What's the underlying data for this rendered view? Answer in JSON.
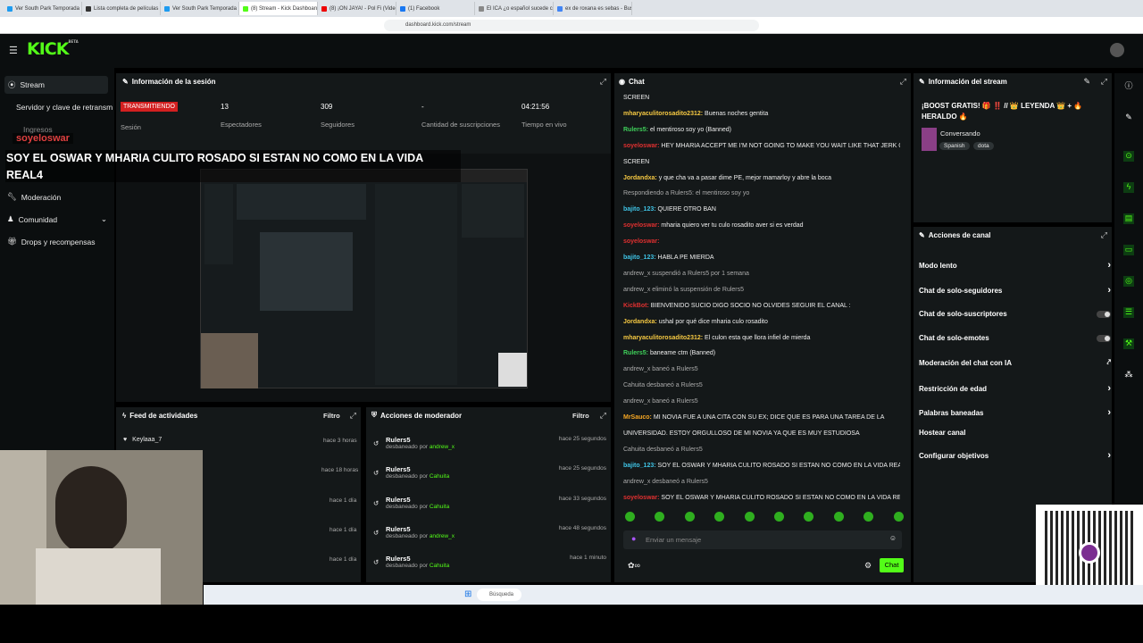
{
  "browser": {
    "tabs": [
      "Ver South Park Temporada 19 Episo",
      "Lista completa de películas Página 1",
      "Ver South Park Temporada 18 Episo",
      "(8) Stream - Kick Dashboard",
      "(8) ¡ON JAYA! - Pol Fi (Video Oficial)",
      "(1) Facebook",
      "El ICA ¿o español sucede con el Pedro",
      "ex de roxana es sebas - Buscar con G"
    ],
    "url": "dashboard.kick.com/stream"
  },
  "brand": {
    "logo": "KICK",
    "beta": "BETA",
    "accent": "#53fc18"
  },
  "sidebar": {
    "items": [
      {
        "label": "Stream",
        "icon": "video-icon"
      },
      {
        "label": "Servidor y clave de retransm"
      },
      {
        "label": "Ingresos"
      },
      {
        "label": "Moderación",
        "icon": "wrench-icon"
      },
      {
        "label": "Comunidad",
        "icon": "community-icon"
      },
      {
        "label": "Drops y recompensas",
        "icon": "gift-icon"
      }
    ],
    "overlay_name": "soyeloswar"
  },
  "session": {
    "title": "Información de la sesión",
    "status": "TRANSMITIENDO",
    "session_label": "Sesión",
    "stats": [
      {
        "value": "13",
        "label": "Espectadores"
      },
      {
        "value": "309",
        "label": "Seguidores"
      },
      {
        "value": "-",
        "label": "Cantidad de suscripciones"
      },
      {
        "value": "04:21:56",
        "label": "Tiempo en vivo"
      }
    ]
  },
  "overlay_text": "SOY EL OSWAR Y MHARIA CULITO ROSADO SI ESTAN NO COMO EN LA VIDA REAL4",
  "chat": {
    "title": "Chat",
    "placeholder": "Enviar un mensaje",
    "send": "Chat",
    "messages": [
      {
        "user": "",
        "text": "SCREEN"
      },
      {
        "user": "mharyaculitorosadito2312:",
        "text": "Buenas noches gentita",
        "color": "#f5c842"
      },
      {
        "user": "Rulers5:",
        "text": "el mentiroso soy yo (Banned)",
        "color": "#3fd15a"
      },
      {
        "user": "soyeloswar:",
        "text": "HEY MHARIA ACCEPT ME I'M NOT GOING TO MAKE YOU WAIT LIKE THAT JERK ON THE",
        "color": "#e03030"
      },
      {
        "user": "",
        "text": "SCREEN"
      },
      {
        "user": "Jordandxa:",
        "text": "y que cha va a pasar dime PE, mejor mamarloy y abre la boca",
        "color": "#f5c842"
      },
      {
        "user": "",
        "text": "Respondiendo a Rulers5: el mentiroso soy yo",
        "sys": true
      },
      {
        "user": "bajito_123:",
        "text": "QUIERE OTRO BAN",
        "color": "#3fc4e6"
      },
      {
        "user": "soyeloswar:",
        "text": "mharia quiero ver tu culo rosadito aver si es verdad",
        "color": "#e03030"
      },
      {
        "user": "soyeloswar:",
        "text": "",
        "color": "#e03030"
      },
      {
        "user": "bajito_123:",
        "text": "HABLA PE MIERDA",
        "color": "#3fc4e6"
      },
      {
        "user": "",
        "text": "andrew_x suspendió a Rulers5 por 1 semana",
        "sys": true
      },
      {
        "user": "",
        "text": "andrew_x eliminó la suspensión de Rulers5",
        "sys": true
      },
      {
        "user": "KickBot:",
        "text": "BIENVENIDO SUCIO DIGO SOCIO NO OLVIDES SEGUIR EL CANAL :",
        "color": "#e03030"
      },
      {
        "user": "Jordandxa:",
        "text": "ushal por qué dice mharia culo rosadito",
        "color": "#f5c842"
      },
      {
        "user": "mharyaculitorosadito2312:",
        "text": "El culon esta que llora infiel de mierda",
        "color": "#f5c842"
      },
      {
        "user": "Rulers5:",
        "text": "baneame ctm (Banned)",
        "color": "#3fd15a"
      },
      {
        "user": "",
        "text": "andrew_x baneó a Rulers5",
        "sys": true
      },
      {
        "user": "",
        "text": "Cahuita desbaneó a Rulers5",
        "sys": true
      },
      {
        "user": "",
        "text": "andrew_x baneó a Rulers5",
        "sys": true
      },
      {
        "user": "MrSauco:",
        "text": "MI NOVIA FUE A UNA CITA CON SU EX; DICE QUE ES PARA UNA TAREA DE LA",
        "color": "#f5a623"
      },
      {
        "user": "",
        "text": "UNIVERSIDAD. ESTOY ORGULLOSO DE MI NOVIA YA QUE ES MUY ESTUDIOSA"
      },
      {
        "user": "",
        "text": "Cahuita desbaneó a Rulers5",
        "sys": true
      },
      {
        "user": "bajito_123:",
        "text": "SOY EL OSWAR Y MHARIA CULITO ROSADO SI ESTAN NO COMO EN LA VIDA REAL",
        "color": "#3fc4e6"
      },
      {
        "user": "",
        "text": "andrew_x desbaneó a Rulers5",
        "sys": true
      },
      {
        "user": "soyeloswar:",
        "text": "SOY EL OSWAR Y MHARIA CULITO ROSADO SI ESTAN NO COMO EN LA VIDA REAL4",
        "color": "#e03030"
      }
    ]
  },
  "stream_info": {
    "title": "Información del stream",
    "stream_title": "¡BOOST GRATIS! 🎁 ‼️ // 👑 LEYENDA 👑 + 🔥 HERALDO 🔥",
    "category": "Conversando",
    "tags": [
      "Spanish",
      "dota"
    ]
  },
  "channel_actions": {
    "title": "Acciones de canal",
    "items": [
      {
        "label": "Modo lento",
        "control": "chevron"
      },
      {
        "label": "Chat de solo-seguidores",
        "control": "chevron"
      },
      {
        "label": "Chat de solo-suscriptores",
        "control": "toggle"
      },
      {
        "label": "Chat de solo-emotes",
        "control": "toggle"
      },
      {
        "label": "Moderación del chat con IA",
        "control": "external"
      },
      {
        "label": "Restricción de edad",
        "control": "chevron"
      },
      {
        "label": "Palabras baneadas",
        "control": "chevron"
      },
      {
        "label": "Hostear canal",
        "control": "none"
      },
      {
        "label": "Configurar objetivos",
        "control": "chevron"
      }
    ]
  },
  "activity": {
    "title": "Feed de actividades",
    "filter": "Filtro",
    "items": [
      {
        "name": "Keylaaa_7",
        "time": "hace 3 horas"
      },
      {
        "name": "",
        "time": "hace 18 horas"
      },
      {
        "name": "",
        "time": "hace 1 día"
      },
      {
        "name": "",
        "time": "hace 1 día"
      },
      {
        "name": "",
        "time": "hace 1 día"
      }
    ]
  },
  "mod_actions": {
    "title": "Acciones de moderador",
    "filter": "Filtro",
    "items": [
      {
        "name": "Rulers5",
        "desc": "desbaneado por",
        "by": "andrew_x",
        "time": "hace 25 segundos"
      },
      {
        "name": "Rulers5",
        "desc": "desbaneado por",
        "by": "Cahuita",
        "time": "hace 25 segundos"
      },
      {
        "name": "Rulers5",
        "desc": "desbaneado por",
        "by": "Cahuita",
        "time": "hace 33 segundos"
      },
      {
        "name": "Rulers5",
        "desc": "desbaneado por",
        "by": "andrew_x",
        "time": "hace 48 segundos"
      },
      {
        "name": "Rulers5",
        "desc": "desbaneado por",
        "by": "Cahuita",
        "time": "hace 1 minuto"
      }
    ]
  },
  "taskbar": {
    "search": "Búsqueda"
  }
}
